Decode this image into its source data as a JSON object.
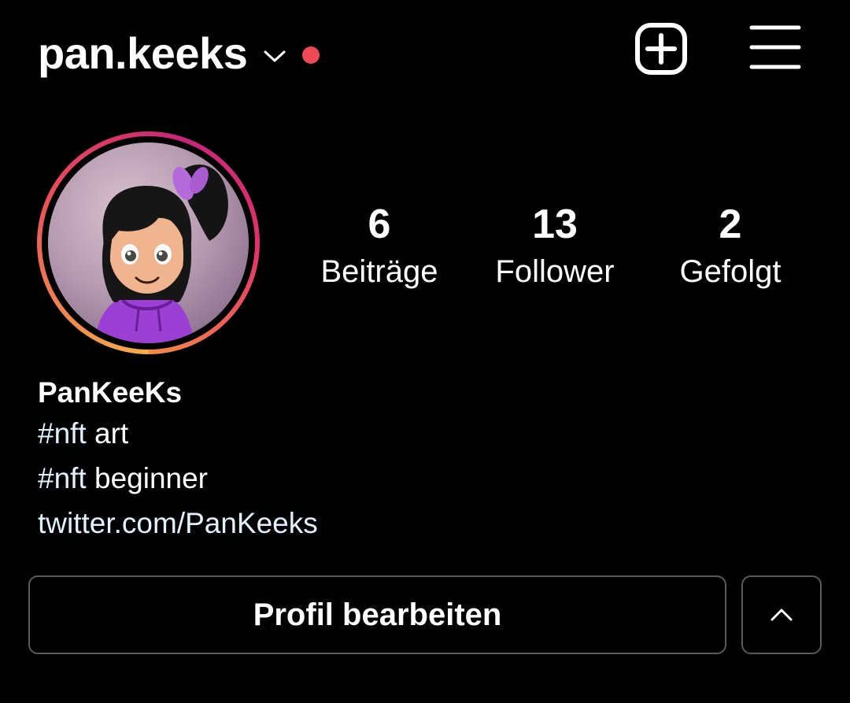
{
  "header": {
    "username": "pan.keeks",
    "account_switcher_icon": "chevron-down-icon",
    "notification_dot_color": "#ed4956",
    "new_post_icon": "add-square-icon",
    "menu_icon": "hamburger-menu-icon"
  },
  "avatar": {
    "story_ring_colors": [
      "#f5b04a",
      "#e8465a",
      "#c8267a"
    ]
  },
  "stats": [
    {
      "value": "6",
      "label": "Beiträge"
    },
    {
      "value": "13",
      "label": "Follower"
    },
    {
      "value": "2",
      "label": "Gefolgt"
    }
  ],
  "bio": {
    "display_name": "PanKeeKs",
    "lines": [
      {
        "hashtag": "#nft",
        "text": " art"
      },
      {
        "hashtag": "#nft",
        "text": " beginner"
      }
    ],
    "link": "twitter.com/PanKeeks"
  },
  "actions": {
    "edit_profile_label": "Profil bearbeiten",
    "expand_icon": "chevron-up-icon"
  }
}
